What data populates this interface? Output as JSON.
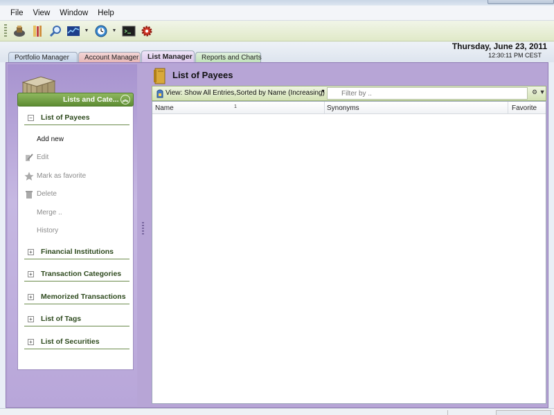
{
  "menu": [
    "File",
    "View",
    "Window",
    "Help"
  ],
  "toolbar": {
    "icons": [
      "portfolio-icon",
      "book-icon",
      "search-icon",
      "chart-icon",
      "clock-icon",
      "terminal-icon",
      "settings-gear-icon"
    ]
  },
  "tabs": [
    "Portfolio Manager",
    "Account Manager",
    "List Manager",
    "Reports and Charts"
  ],
  "active_tab": "List Manager",
  "datetime": {
    "date": "Thursday, June 23, 2011",
    "time": "12:30:11 PM CEST"
  },
  "left": {
    "header": "Lists and Cate...",
    "open_section": "List of Payees",
    "actions": [
      "Add new",
      "Edit",
      "Mark as favorite",
      "Delete",
      "Merge ..",
      "History"
    ],
    "sections": [
      "Financial Institutions",
      "Transaction Categories",
      "Memorized Transactions",
      "List of Tags",
      "List of Securities"
    ]
  },
  "right": {
    "title": "List of Payees",
    "view_label": "View: Show All Entries,Sorted by Name (Increasing)",
    "filter_placeholder": "Filter by ..",
    "sort_indicator": "1",
    "columns": [
      "Name",
      "Synonyms",
      "Favorite"
    ]
  },
  "colors": {
    "frame_purple": "#b7a5d6",
    "header_green": "#5d8c33",
    "tab_active": "#d8c3ea"
  }
}
